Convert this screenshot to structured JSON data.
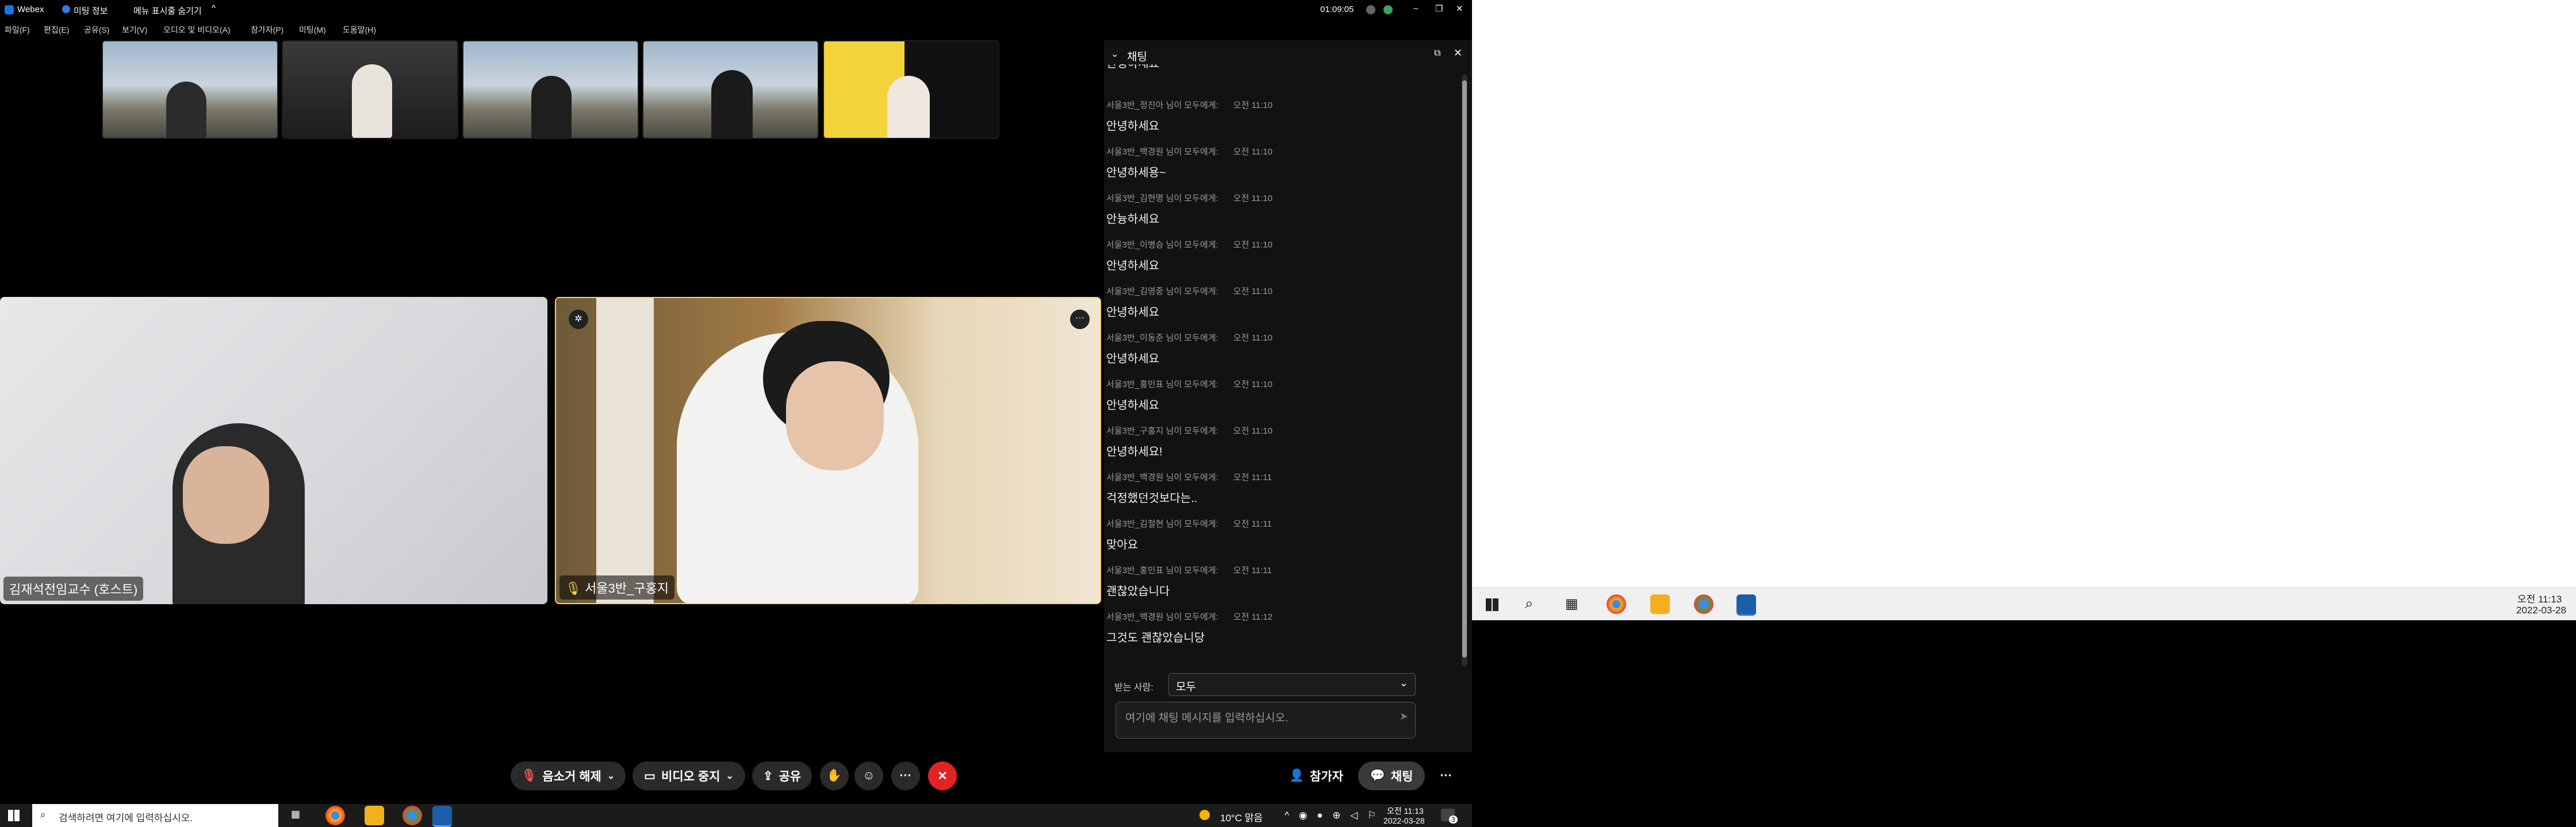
{
  "titlebar": {
    "app_name": "Webex",
    "meeting_info": "미팅 정보",
    "hide_menu": "메뉴 표시줄 숨기기",
    "clock": "01:09:05"
  },
  "menu": {
    "items": [
      "파일(F)",
      "편집(E)",
      "공유(S)",
      "보기(V)",
      "오디오 및 비디오(A)",
      "참가자(P)",
      "미팅(M)",
      "도움말(H)"
    ]
  },
  "main_videos": [
    {
      "name": "김재석전임교수 (호스트)"
    },
    {
      "name": "서울3반_구홍지"
    }
  ],
  "chat": {
    "header": "채팅",
    "truncated_top": "안녕하세요",
    "messages": [
      {
        "sender": "서울3반_정진아 님이 모두에게:",
        "time": "오전 11:10",
        "text": "안녕하세요"
      },
      {
        "sender": "서울3반_백경원 님이 모두에게:",
        "time": "오전 11:10",
        "text": "안녕하세용~"
      },
      {
        "sender": "서울3반_김현명 님이 모두에게:",
        "time": "오전 11:10",
        "text": "안늉하세요"
      },
      {
        "sender": "서울3반_이병승 님이 모두에게:",
        "time": "오전 11:10",
        "text": "안녕하세요"
      },
      {
        "sender": "서울3반_김영중 님이 모두에게:",
        "time": "오전 11:10",
        "text": "안녕하세요"
      },
      {
        "sender": "서울3반_이동준 님이 모두에게:",
        "time": "오전 11:10",
        "text": "안녕하세요"
      },
      {
        "sender": "서울3반_홍민표 님이 모두에게:",
        "time": "오전 11:10",
        "text": "안녕하세요"
      },
      {
        "sender": "서울3반_구홍지 님이 모두에게:",
        "time": "오전 11:10",
        "text": "안녕하세요!"
      },
      {
        "sender": "서울3반_백경원 님이 모두에게:",
        "time": "오전 11:11",
        "text": "걱정했던것보다는.."
      },
      {
        "sender": "서울3반_김철현 님이 모두에게:",
        "time": "오전 11:11",
        "text": "맞아요"
      },
      {
        "sender": "서울3반_홍민표 님이 모두에게:",
        "time": "오전 11:11",
        "text": "괜찮았습니다"
      },
      {
        "sender": "서울3반_백경원 님이 모두에게:",
        "time": "오전 11:12",
        "text": "그것도 괜찮았습니당"
      }
    ],
    "recipient_label": "받는 사람:",
    "recipient_value": "모두",
    "input_placeholder": "여기에 채팅 메시지를 입력하십시오."
  },
  "controls": {
    "unmute": "음소거 해제",
    "stop_video": "비디오 중지",
    "share": "공유",
    "participants": "참가자",
    "chat": "채팅"
  },
  "taskbar_left": {
    "search_placeholder": "검색하려면 여기에 입력하십시오.",
    "weather": "10°C 맑음",
    "time": "오전 11:13",
    "date": "2022-03-28",
    "notification_count": "3"
  },
  "taskbar_right": {
    "time": "오전 11:13",
    "date": "2022-03-28"
  },
  "colors": {
    "webex_bg": "#000000",
    "chat_bg": "#121212",
    "leave_red": "#e02424",
    "accent_blue": "#3b82f6"
  }
}
